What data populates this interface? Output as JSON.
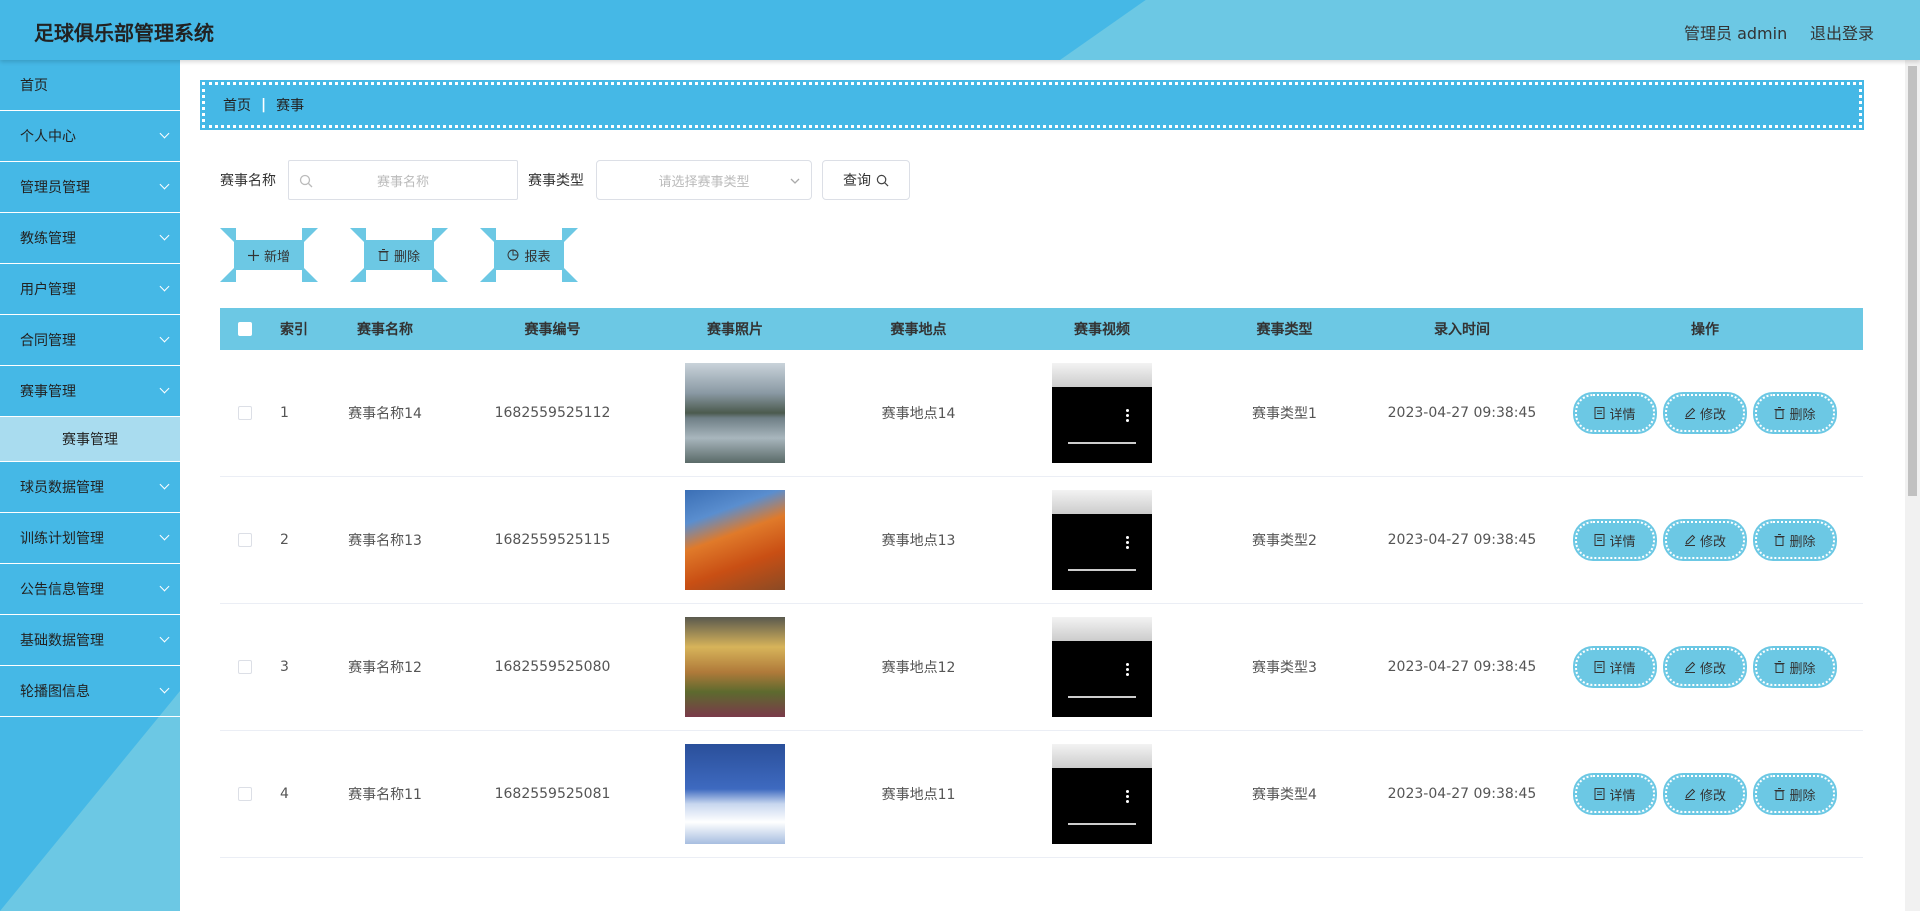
{
  "header": {
    "title": "足球俱乐部管理系统",
    "admin_label": "管理员 admin",
    "logout_label": "退出登录"
  },
  "sidebar": {
    "items": [
      {
        "label": "首页",
        "has_children": false
      },
      {
        "label": "个人中心",
        "has_children": true
      },
      {
        "label": "管理员管理",
        "has_children": true
      },
      {
        "label": "教练管理",
        "has_children": true
      },
      {
        "label": "用户管理",
        "has_children": true
      },
      {
        "label": "合同管理",
        "has_children": true
      },
      {
        "label": "赛事管理",
        "has_children": true
      },
      {
        "label": "赛事管理",
        "sub": true
      },
      {
        "label": "球员数据管理",
        "has_children": true
      },
      {
        "label": "训练计划管理",
        "has_children": true
      },
      {
        "label": "公告信息管理",
        "has_children": true
      },
      {
        "label": "基础数据管理",
        "has_children": true
      },
      {
        "label": "轮播图信息",
        "has_children": true
      }
    ]
  },
  "breadcrumb": {
    "home": "首页",
    "current": "赛事"
  },
  "search": {
    "name_label": "赛事名称",
    "name_placeholder": "赛事名称",
    "type_label": "赛事类型",
    "type_placeholder": "请选择赛事类型",
    "query_label": "查询"
  },
  "actions": {
    "add_label": "新增",
    "delete_label": "删除",
    "report_label": "报表"
  },
  "table": {
    "columns": [
      "索引",
      "赛事名称",
      "赛事编号",
      "赛事照片",
      "赛事地点",
      "赛事视频",
      "赛事类型",
      "录入时间",
      "操作"
    ],
    "rows": [
      {
        "index": "1",
        "name": "赛事名称14",
        "code": "1682559525112",
        "location": "赛事地点14",
        "type": "赛事类型1",
        "time": "2023-04-27 09:38:45",
        "photo": "lake-mountain-village"
      },
      {
        "index": "2",
        "name": "赛事名称13",
        "code": "1682559525115",
        "location": "赛事地点13",
        "type": "赛事类型2",
        "time": "2023-04-27 09:38:45",
        "photo": "orange-mountain-peak"
      },
      {
        "index": "3",
        "name": "赛事名称12",
        "code": "1682559525080",
        "location": "赛事地点12",
        "type": "赛事类型3",
        "time": "2023-04-27 09:38:45",
        "photo": "sunset-hillside"
      },
      {
        "index": "4",
        "name": "赛事名称11",
        "code": "1682559525081",
        "location": "赛事地点11",
        "type": "赛事类型4",
        "time": "2023-04-27 09:38:45",
        "photo": "snowy-cabin-night"
      }
    ],
    "op_labels": {
      "detail": "详情",
      "edit": "修改",
      "delete": "删除"
    }
  },
  "colors": {
    "primary": "#45b8e6",
    "accent": "#6cc8e4"
  }
}
